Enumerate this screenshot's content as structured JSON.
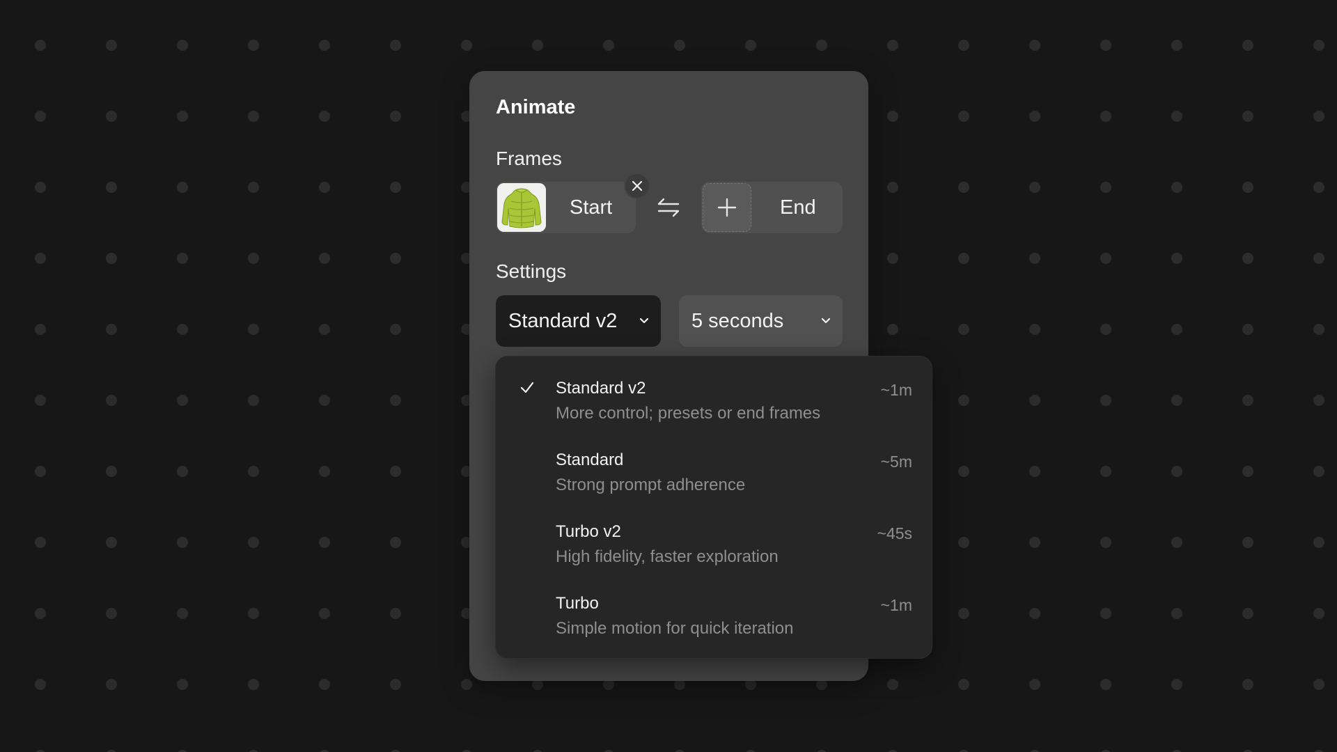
{
  "panel": {
    "title": "Animate"
  },
  "frames": {
    "label": "Frames",
    "start_label": "Start",
    "end_label": "End",
    "start_icon": "jacket-thumbnail",
    "remove_icon": "close-icon",
    "swap_icon": "swap-arrows-icon",
    "add_icon": "plus-icon"
  },
  "settings": {
    "label": "Settings",
    "model_value": "Standard v2",
    "duration_value": "5 seconds"
  },
  "model_options": [
    {
      "title": "Standard v2",
      "description": "More control; presets or end frames",
      "time": "~1m",
      "selected": true
    },
    {
      "title": "Standard",
      "description": "Strong prompt adherence",
      "time": "~5m",
      "selected": false
    },
    {
      "title": "Turbo v2",
      "description": "High fidelity, faster exploration",
      "time": "~45s",
      "selected": false
    },
    {
      "title": "Turbo",
      "description": "Simple motion for quick iteration",
      "time": "~1m",
      "selected": false
    }
  ],
  "colors": {
    "background": "#171717",
    "panel": "#454545",
    "dropdown": "#262626",
    "selected_select": "#1d1d1d",
    "jacket": "#a7c736"
  }
}
